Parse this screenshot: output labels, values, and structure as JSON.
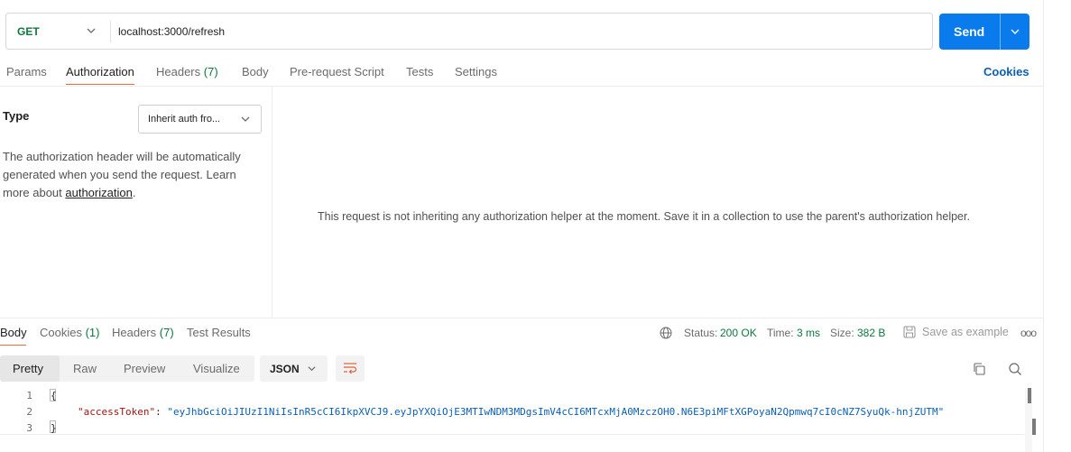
{
  "request": {
    "method": "GET",
    "url": "localhost:3000/refresh",
    "send_label": "Send"
  },
  "request_tabs": {
    "params": "Params",
    "authorization": "Authorization",
    "headers": "Headers",
    "headers_count": "(7)",
    "body": "Body",
    "prerequest": "Pre-request Script",
    "tests": "Tests",
    "settings": "Settings",
    "cookies": "Cookies"
  },
  "auth": {
    "type_label": "Type",
    "type_value": "Inherit auth fro...",
    "description_1": "The authorization header will be automatically generated when you send the request. Learn more about ",
    "description_link": "authorization",
    "description_end": ".",
    "message": "This request is not inheriting any authorization helper at the moment. Save it in a collection to use the parent's authorization helper."
  },
  "response_tabs": {
    "body": "Body",
    "cookies": "Cookies",
    "cookies_count": "(1)",
    "headers": "Headers",
    "headers_count": "(7)",
    "test_results": "Test Results"
  },
  "status": {
    "status_label": "Status:",
    "status_value": "200 OK",
    "time_label": "Time:",
    "time_value": "3 ms",
    "size_label": "Size:",
    "size_value": "382 B",
    "save_example": "Save as example",
    "more": "ooo"
  },
  "format": {
    "pretty": "Pretty",
    "raw": "Raw",
    "preview": "Preview",
    "visualize": "Visualize",
    "language": "JSON"
  },
  "code": {
    "line_numbers": [
      "1",
      "2",
      "3"
    ],
    "open_brace": "{",
    "key": "\"accessToken\"",
    "colon": ": ",
    "value": "\"eyJhbGciOiJIUzI1NiIsInR5cCI6IkpXVCJ9.eyJpYXQiOjE3MTIwNDM3MDgsImV4cCI6MTcxMjA0MzczOH0.N6E3piMFtXGPoyaN2Qpmwq7cI0cNZ7SyuQk-hnjZUTM\"",
    "close_brace": "}"
  },
  "colors": {
    "accent": "#f26b3a",
    "send_button": "#097bed",
    "success": "#0b7a3c",
    "link": "#0b5fb3"
  },
  "icons": [
    "chevron-down-icon",
    "globe-icon",
    "save-icon",
    "more-icon",
    "wrap-lines-icon",
    "copy-icon",
    "search-icon"
  ]
}
